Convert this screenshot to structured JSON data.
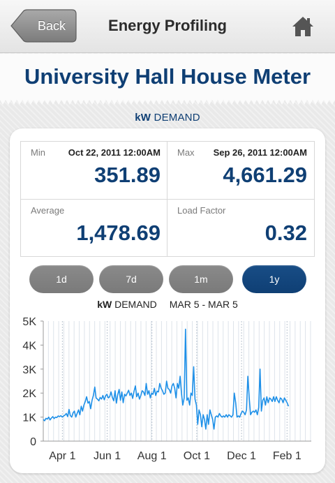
{
  "nav": {
    "back_label": "Back",
    "title": "Energy Profiling",
    "home_icon": "home-icon"
  },
  "meter": {
    "title": "University Hall House Meter"
  },
  "section": {
    "metric": "kW",
    "label": "DEMAND"
  },
  "stats": {
    "min": {
      "label": "Min",
      "date": "Oct 22, 2011 12:00AM",
      "value": "351.89"
    },
    "max": {
      "label": "Max",
      "date": "Sep 26, 2011 12:00AM",
      "value": "4,661.29"
    },
    "average": {
      "label": "Average",
      "value": "1,478.69"
    },
    "load_factor": {
      "label": "Load Factor",
      "value": "0.32"
    }
  },
  "periods": {
    "items": [
      "1d",
      "7d",
      "1m",
      "1y"
    ],
    "selected": "1y"
  },
  "range": {
    "metric": "kW",
    "label": "DEMAND",
    "dates": "MAR 5 - MAR 5"
  },
  "colors": {
    "brand_blue": "#0f3f74",
    "series_line": "#1e90e8",
    "button_gray": "#808080",
    "grid": "#d6dde6"
  },
  "chart_data": {
    "type": "line",
    "title": "",
    "xlabel": "",
    "ylabel": "",
    "ylim": [
      0,
      5000
    ],
    "y_ticks": [
      "0",
      "1K",
      "2K",
      "3K",
      "4K",
      "5K"
    ],
    "y_tick_values": [
      0,
      1000,
      2000,
      3000,
      4000,
      5000
    ],
    "x_ticks": [
      "Apr 1",
      "Jun 1",
      "Aug 1",
      "Oct 1",
      "Dec 1",
      "Feb 1"
    ],
    "x_tick_days": [
      26,
      87,
      148,
      209,
      270,
      332
    ],
    "xlim_days": [
      0,
      365
    ],
    "grid": "vertical",
    "series": [
      {
        "name": "",
        "values": [
          900,
          850,
          950,
          920,
          1000,
          880,
          960,
          1020,
          940,
          1000,
          980,
          1050,
          1020,
          1060,
          1000,
          1050,
          1080,
          1150,
          1020,
          1320,
          1060,
          1000,
          1180,
          1250,
          1000,
          1150,
          1300,
          1100,
          1450,
          1250,
          1500,
          1650,
          1850,
          1580,
          1650,
          1350,
          1700,
          1900,
          2250,
          1800,
          1750,
          1680,
          1820,
          1750,
          1900,
          1720,
          1880,
          1950,
          1800,
          1850,
          2050,
          1820,
          1680,
          2100,
          1580,
          1950,
          2150,
          1700,
          2050,
          1600,
          1950,
          1880,
          2000,
          2120,
          1900,
          2000,
          1780,
          2080,
          2300,
          1850,
          2000,
          1750,
          1900,
          2100,
          2050,
          1900,
          2400,
          1950,
          2100,
          1800,
          2000,
          1950,
          2200,
          1900,
          2080,
          2050,
          2400,
          2200,
          2100,
          1950,
          2000,
          2500,
          2200,
          2150,
          2000,
          2300,
          2400,
          2200,
          1800,
          2400,
          2200,
          2700,
          2000,
          1500,
          1800,
          4661,
          1700,
          1800,
          1500,
          2000,
          1900,
          3100,
          1750,
          1500,
          700,
          1300,
          1100,
          600,
          1100,
          900,
          500,
          1100,
          700,
          1300,
          1100,
          900,
          500,
          1000,
          1050,
          1000,
          1150,
          1050,
          1000,
          1050,
          1000,
          1100,
          1000,
          1100,
          1050,
          1000,
          1100,
          2000,
          1600,
          1000,
          1050,
          1000,
          1150,
          1250,
          1200,
          1100,
          1300,
          2700,
          1800,
          1100,
          1200,
          1250,
          1200,
          1300,
          1100,
          1400,
          3000,
          1250,
          1700,
          1800,
          1500,
          1850,
          1600,
          1800,
          1750,
          1650,
          1850,
          1650,
          1850,
          1700,
          1600,
          1800,
          1750,
          1600,
          1800,
          1700,
          1600,
          1450
        ]
      }
    ]
  }
}
